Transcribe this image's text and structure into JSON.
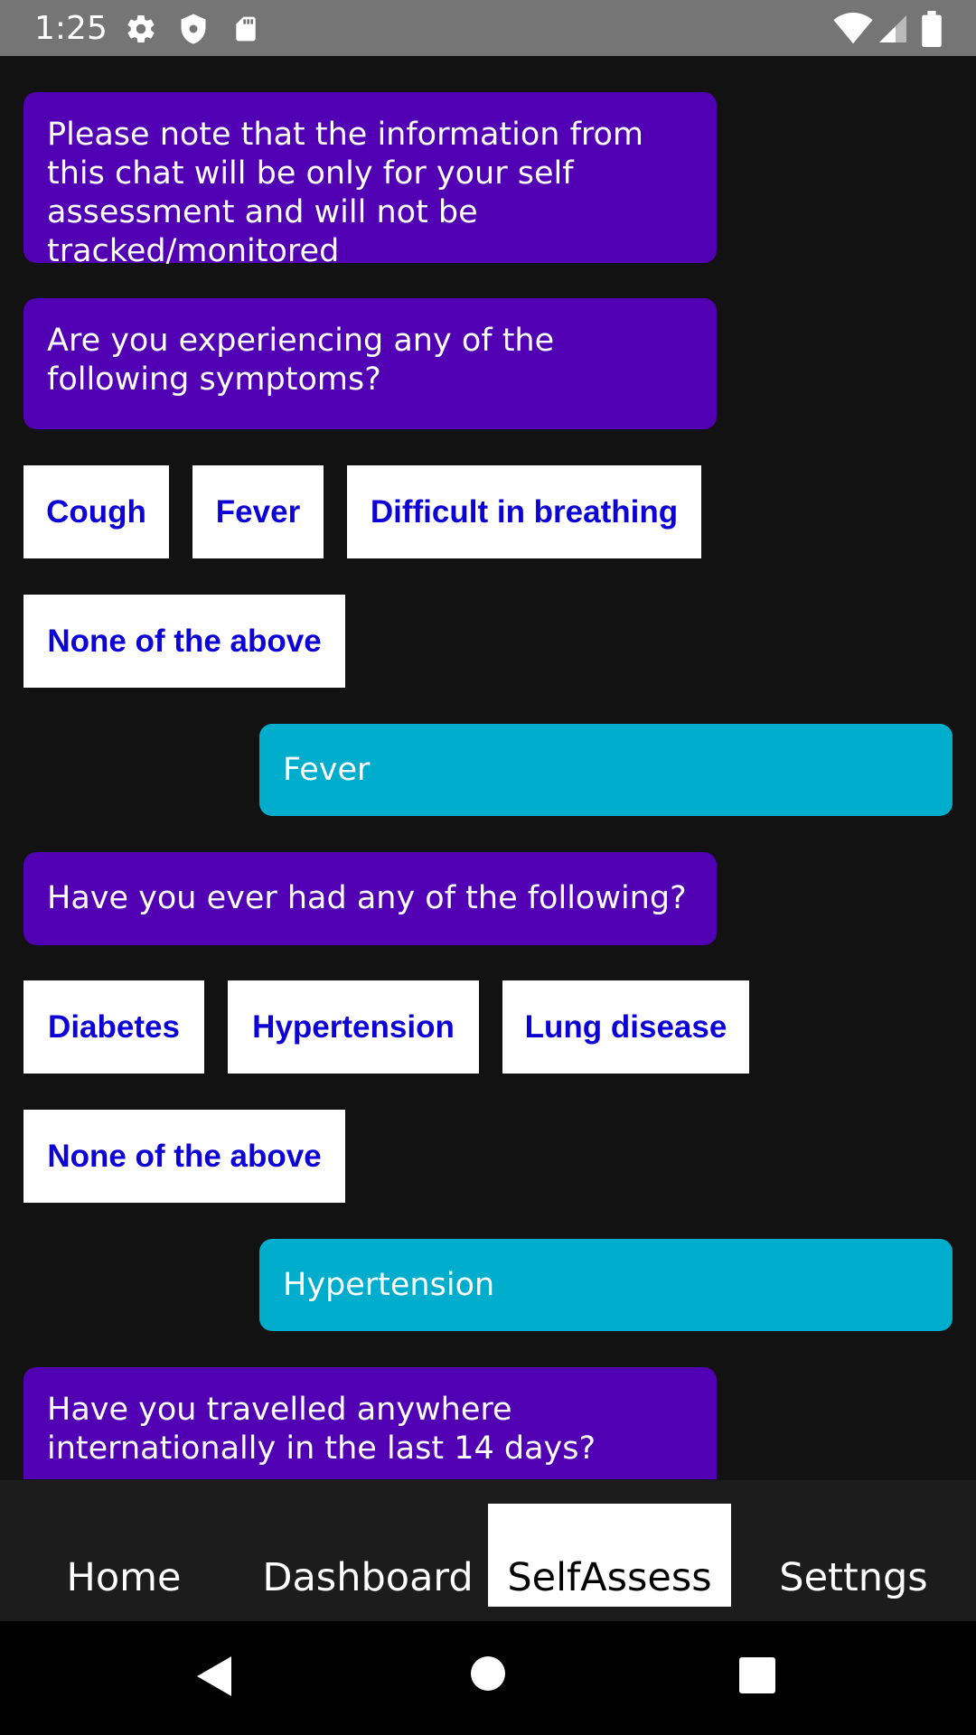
{
  "status_bar": {
    "time": "1:25",
    "icons": [
      "gear-icon",
      "shield-icon",
      "sd-card-icon",
      "wifi-icon",
      "signal-icon",
      "battery-icon"
    ]
  },
  "chat": {
    "messages": [
      {
        "text": "Please note that the information from this chat will be only for your self assessment and will not be tracked/monitored"
      },
      {
        "text": "Are you experiencing any of the following symptoms?"
      },
      {
        "text": "Have you ever had any of the following?"
      },
      {
        "text": "Have you travelled anywhere internationally in the last 14 days?"
      }
    ],
    "symptom_options": [
      "Cough",
      "Fever",
      "Difficult in breathing",
      "None of the above"
    ],
    "user_reply_1": "Fever",
    "condition_options": [
      "Diabetes",
      "Hypertension",
      "Lung disease",
      "None of the above"
    ],
    "user_reply_2": "Hypertension"
  },
  "tabs": [
    {
      "label": "Home"
    },
    {
      "label": "Dashboard"
    },
    {
      "label": "SelfAssess"
    },
    {
      "label": "Settngs"
    }
  ],
  "active_tab": "SelfAssess",
  "colors": {
    "bot_bubble": "#5100b4",
    "user_bubble": "#00adcc",
    "option_text": "#0d00d6",
    "background": "#121212",
    "status_bar": "#757575"
  },
  "nav_buttons": [
    "back-icon",
    "home-icon",
    "recents-icon"
  ]
}
